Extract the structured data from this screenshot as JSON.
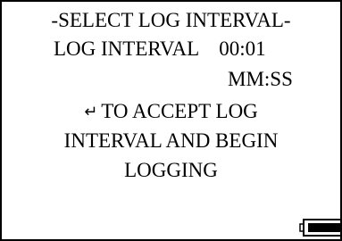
{
  "screen": {
    "title": "-SELECT LOG INTERVAL-",
    "interval_label": "LOG INTERVAL",
    "interval_value": "00:01",
    "units": "MM:SS",
    "enter_symbol": "↵",
    "instruction_line1": "TO ACCEPT LOG",
    "instruction_line2": "INTERVAL AND BEGIN",
    "instruction_line3": "LOGGING",
    "battery_icon": "battery-icon"
  }
}
